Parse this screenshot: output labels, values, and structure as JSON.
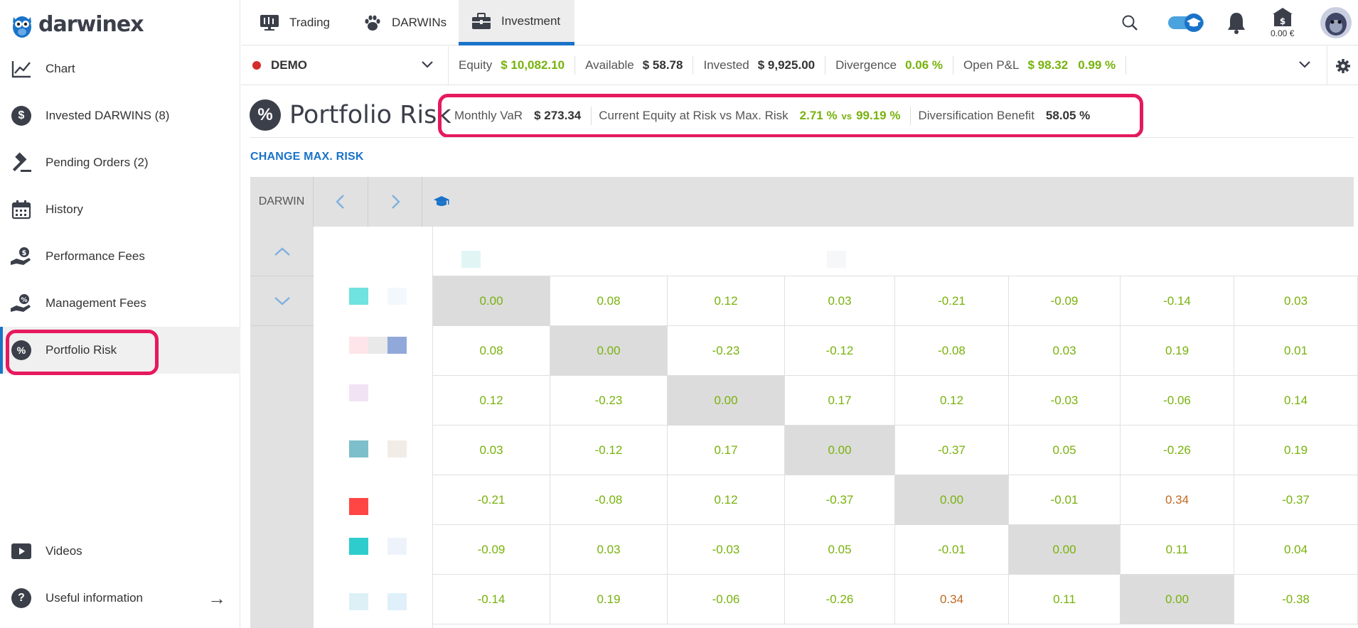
{
  "brand": {
    "name": "darwinex"
  },
  "sidebar": {
    "items": [
      {
        "label": "Chart",
        "icon": "chart-line-icon"
      },
      {
        "label": "Invested DARWINS (8)",
        "icon": "dollar-circle-icon"
      },
      {
        "label": "Pending Orders (2)",
        "icon": "gavel-icon"
      },
      {
        "label": "History",
        "icon": "calendar-icon"
      },
      {
        "label": "Performance Fees",
        "icon": "hand-dollar-icon"
      },
      {
        "label": "Management Fees",
        "icon": "hand-percent-icon"
      },
      {
        "label": "Portfolio Risk",
        "icon": "percent-circle-icon",
        "active": true
      }
    ],
    "bottom": [
      {
        "label": "Videos",
        "icon": "play-icon"
      },
      {
        "label": "Useful information",
        "icon": "question-icon"
      }
    ]
  },
  "topnav": {
    "tabs": [
      {
        "label": "Trading",
        "icon": "trading-icon"
      },
      {
        "label": "DARWINs",
        "icon": "paw-icon"
      },
      {
        "label": "Investment",
        "icon": "briefcase-icon",
        "active": true
      }
    ],
    "wallet_balance": "0.00 €"
  },
  "account": {
    "name": "DEMO",
    "equity_label": "Equity",
    "equity": "$ 10,082.10",
    "available_label": "Available",
    "available": "$ 58.78",
    "invested_label": "Invested",
    "invested": "$ 9,925.00",
    "divergence_label": "Divergence",
    "divergence": "0.06 %",
    "pnl_label": "Open P&L",
    "pnl": "$ 98.32",
    "pnl_pct": "0.99 %"
  },
  "page": {
    "title": "Portfolio Risk",
    "var_label": "Monthly VaR",
    "var": "$ 273.34",
    "eq_risk_label": "Current Equity at Risk vs Max. Risk",
    "eq_risk": "2.71 %",
    "vs": "vs",
    "max_risk": "99.19 %",
    "div_label": "Diversification Benefit",
    "div": "58.05 %",
    "change_link": "CHANGE MAX. RISK"
  },
  "matrix": {
    "header_label": "DARWIN",
    "rows": [
      [
        "0.00",
        "0.08",
        "0.12",
        "0.03",
        "-0.21",
        "-0.09",
        "-0.14",
        "0.03"
      ],
      [
        "0.08",
        "0.00",
        "-0.23",
        "-0.12",
        "-0.08",
        "0.03",
        "0.19",
        "0.01"
      ],
      [
        "0.12",
        "-0.23",
        "0.00",
        "0.17",
        "0.12",
        "-0.03",
        "-0.06",
        "0.14"
      ],
      [
        "0.03",
        "-0.12",
        "0.17",
        "0.00",
        "-0.37",
        "0.05",
        "-0.26",
        "0.19"
      ],
      [
        "-0.21",
        "-0.08",
        "0.12",
        "-0.37",
        "0.00",
        "-0.01",
        "0.34",
        "-0.37"
      ],
      [
        "-0.09",
        "0.03",
        "-0.03",
        "0.05",
        "-0.01",
        "0.00",
        "0.11",
        "0.04"
      ],
      [
        "-0.14",
        "0.19",
        "-0.06",
        "-0.26",
        "0.34",
        "0.11",
        "0.00",
        "-0.38"
      ]
    ]
  },
  "colors": {
    "accent": "#1a73c8",
    "highlight": "#e6195e",
    "green": "#78b20c",
    "orange": "#c06a23"
  }
}
